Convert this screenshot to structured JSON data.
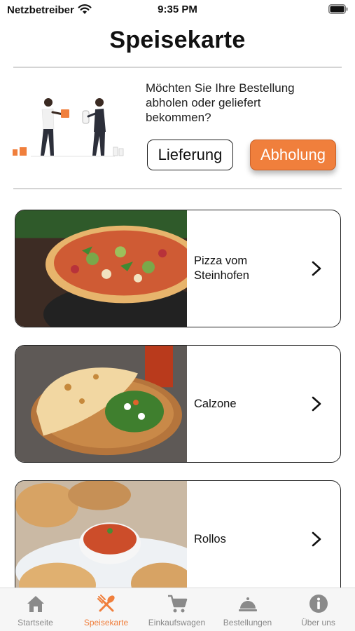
{
  "status_bar": {
    "carrier": "Netzbetreiber",
    "time": "9:35 PM"
  },
  "header": {
    "title": "Speisekarte"
  },
  "order_banner": {
    "question": "Möchten Sie Ihre Bestellung abholen oder geliefert bekommen?",
    "delivery_label": "Lieferung",
    "pickup_label": "Abholung",
    "accent_color": "#f07f3c"
  },
  "categories": [
    {
      "label": "Pizza vom Steinhofen",
      "icon": "chevron-right-icon"
    },
    {
      "label": "Calzone",
      "icon": "chevron-right-icon"
    },
    {
      "label": "Rollos",
      "icon": "chevron-right-icon"
    }
  ],
  "tab_bar": {
    "active": "Speisekarte",
    "items": [
      {
        "label": "Startseite",
        "icon": "home-icon"
      },
      {
        "label": "Speisekarte",
        "icon": "utensils-icon"
      },
      {
        "label": "Einkaufswagen",
        "icon": "cart-icon"
      },
      {
        "label": "Bestellungen",
        "icon": "cloche-icon"
      },
      {
        "label": "Über uns",
        "icon": "info-icon"
      }
    ]
  }
}
